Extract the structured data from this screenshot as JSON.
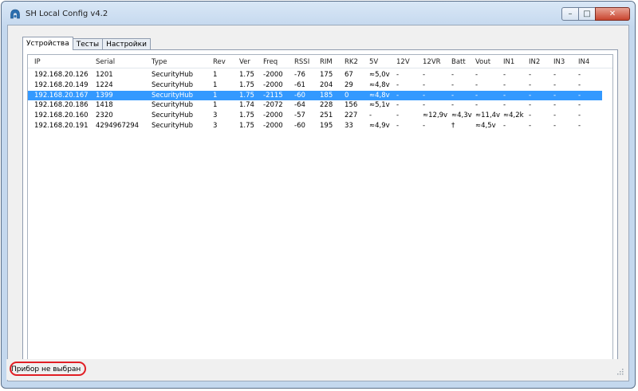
{
  "window": {
    "title": "SH Local Config v4.2",
    "controls": {
      "minimize": "–",
      "maximize": "□",
      "close": "✕"
    }
  },
  "tabs": [
    {
      "label": "Устройства",
      "active": true
    },
    {
      "label": "Тесты",
      "active": false
    },
    {
      "label": "Настройки",
      "active": false
    }
  ],
  "table": {
    "columns": [
      "IP",
      "Serial",
      "Type",
      "Rev",
      "Ver",
      "Freq",
      "RSSI",
      "RIM",
      "RK2",
      "5V",
      "12V",
      "12VR",
      "Batt",
      "Vout",
      "IN1",
      "IN2",
      "IN3",
      "IN4"
    ],
    "rows": [
      [
        "192.168.20.126",
        "1201",
        "SecurityHub",
        "1",
        "1.75",
        "-2000",
        "-76",
        "175",
        "67",
        "≈5,0v",
        "-",
        "-",
        "-",
        "-",
        "-",
        "-",
        "-",
        "-"
      ],
      [
        "192.168.20.149",
        "1224",
        "SecurityHub",
        "1",
        "1.75",
        "-2000",
        "-61",
        "204",
        "29",
        "≈4,8v",
        "-",
        "-",
        "-",
        "-",
        "-",
        "-",
        "-",
        "-"
      ],
      [
        "192.168.20.167",
        "1399",
        "SecurityHub",
        "1",
        "1.75",
        "-2115",
        "-60",
        "185",
        "0",
        "≈4,8v",
        "-",
        "-",
        "-",
        "-",
        "-",
        "-",
        "-",
        "-"
      ],
      [
        "192.168.20.186",
        "1418",
        "SecurityHub",
        "1",
        "1.74",
        "-2072",
        "-64",
        "228",
        "156",
        "≈5,1v",
        "-",
        "-",
        "-",
        "-",
        "-",
        "-",
        "-",
        "-"
      ],
      [
        "192.168.20.160",
        "2320",
        "SecurityHub",
        "3",
        "1.75",
        "-2000",
        "-57",
        "251",
        "227",
        "-",
        "-",
        "≈12,9v",
        "≈4,3v",
        "≈11,4v",
        "≈4,2k",
        "-",
        "-",
        "-"
      ],
      [
        "192.168.20.191",
        "4294967294",
        "SecurityHub",
        "3",
        "1.75",
        "-2000",
        "-60",
        "195",
        "33",
        "≈4,9v",
        "-",
        "-",
        "†",
        "≈4,5v",
        "-",
        "-",
        "-",
        "-"
      ]
    ],
    "selected_row": 2
  },
  "status": {
    "text": "Прибор не выбран"
  },
  "colors": {
    "selection": "#3399ff",
    "highlight_ring": "#e11e24"
  }
}
